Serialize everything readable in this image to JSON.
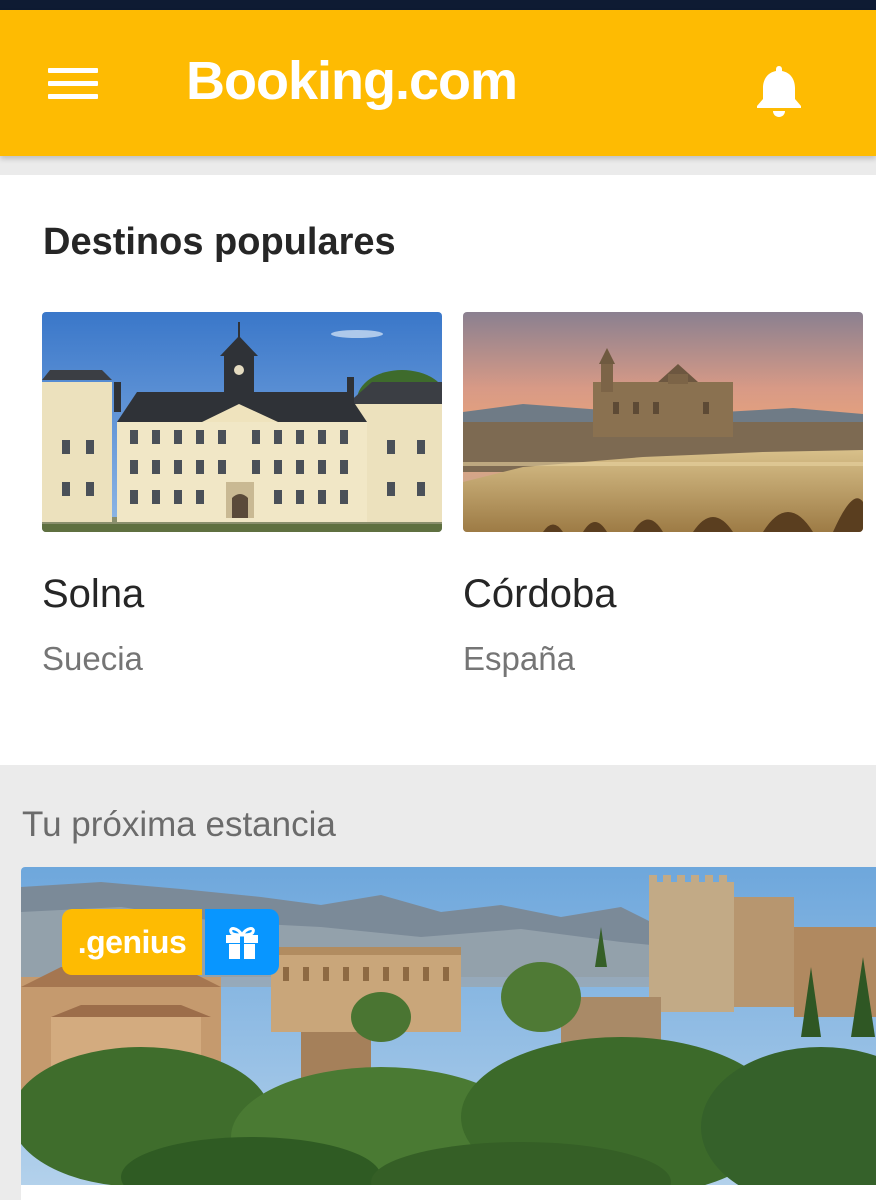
{
  "app": {
    "logo_text": "Booking.com",
    "brand_color": "#febb02",
    "status_bar_color": "#0e1b33",
    "menu_icon": "hamburger-menu-icon",
    "notifications_icon": "bell-icon"
  },
  "popular": {
    "title": "Destinos populares",
    "destinations": [
      {
        "name": "Solna",
        "country": "Suecia",
        "image": "palace-photo"
      },
      {
        "name": "Córdoba",
        "country": "España",
        "image": "mosque-bridge-sunset-photo"
      }
    ]
  },
  "next_stay": {
    "title": "Tu próxima estancia",
    "image": "alhambra-photo",
    "badge": {
      "label": ".genius",
      "icon": "gift-icon",
      "label_color": "#febb02",
      "icon_color": "#0896ff"
    }
  }
}
